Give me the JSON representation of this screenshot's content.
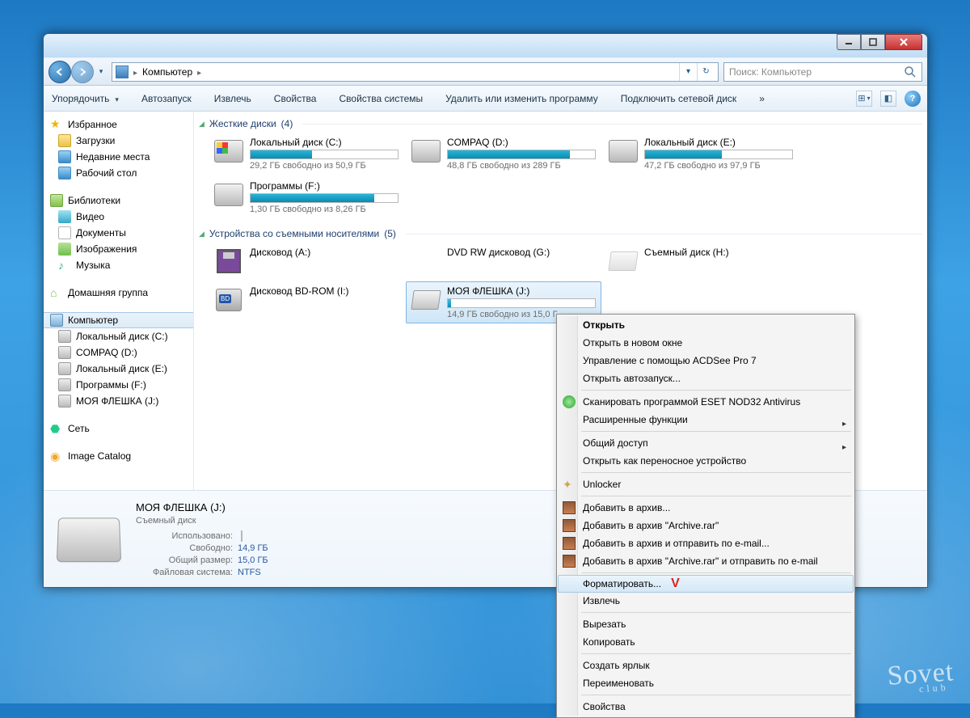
{
  "window": {
    "title": "Компьютер",
    "search_placeholder": "Поиск: Компьютер"
  },
  "toolbar": {
    "organize": "Упорядочить",
    "autoplay": "Автозапуск",
    "eject": "Извлечь",
    "properties": "Свойства",
    "sys_properties": "Свойства системы",
    "uninstall": "Удалить или изменить программу",
    "map_network": "Подключить сетевой диск",
    "more": "»"
  },
  "sidebar": {
    "favorites": {
      "label": "Избранное",
      "items": [
        "Загрузки",
        "Недавние места",
        "Рабочий стол"
      ]
    },
    "libraries": {
      "label": "Библиотеки",
      "items": [
        "Видео",
        "Документы",
        "Изображения",
        "Музыка"
      ]
    },
    "homegroup": "Домашняя группа",
    "computer": {
      "label": "Компьютер",
      "items": [
        "Локальный диск (C:)",
        "COMPAQ (D:)",
        "Локальный диск (E:)",
        "Программы  (F:)",
        "МОЯ ФЛЕШКА (J:)"
      ]
    },
    "network": "Сеть",
    "image_catalog": "Image Catalog"
  },
  "groups": {
    "hdd": {
      "label": "Жесткие диски",
      "count": "(4)"
    },
    "removable": {
      "label": "Устройства со съемными носителями",
      "count": "(5)"
    }
  },
  "drives": {
    "c": {
      "name": "Локальный диск (C:)",
      "sub": "29,2 ГБ свободно из 50,9 ГБ",
      "fill": 42,
      "color": "#25b6d8"
    },
    "d": {
      "name": "COMPAQ (D:)",
      "sub": "48,8 ГБ свободно из 289 ГБ",
      "fill": 83,
      "color": "#25b6d8"
    },
    "e": {
      "name": "Локальный диск (E:)",
      "sub": "47,2 ГБ свободно из 97,9 ГБ",
      "fill": 52,
      "color": "#25b6d8"
    },
    "f": {
      "name": "Программы  (F:)",
      "sub": "1,30 ГБ свободно из 8,26 ГБ",
      "fill": 84,
      "color": "#25b6d8"
    },
    "a": {
      "name": "Дисковод (A:)"
    },
    "g": {
      "name": "DVD RW дисковод (G:)"
    },
    "h": {
      "name": "Съемный диск (H:)"
    },
    "i": {
      "name": "Дисковод BD-ROM (I:)"
    },
    "j": {
      "name": "МОЯ ФЛЕШКА (J:)",
      "sub": "14,9 ГБ свободно из 15,0 Г",
      "fill": 2,
      "color": "#3fbfe5"
    }
  },
  "details": {
    "title": "МОЯ ФЛЕШКА (J:)",
    "type": "Съемный диск",
    "used_label": "Использовано:",
    "free_label": "Свободно:",
    "free_val": "14,9 ГБ",
    "size_label": "Общий размер:",
    "size_val": "15,0 ГБ",
    "fs_label": "Файловая система:",
    "fs_val": "NTFS",
    "used_fill": 2
  },
  "context_menu": {
    "open": "Открыть",
    "open_new": "Открыть в новом окне",
    "acdsee": "Управление с помощью ACDSee Pro 7",
    "autoplay": "Открыть автозапуск...",
    "eset_scan": "Сканировать программой ESET NOD32 Antivirus",
    "advanced": "Расширенные функции",
    "share": "Общий доступ",
    "portable": "Открыть как переносное устройство",
    "unlocker": "Unlocker",
    "add_archive": "Добавить в архив...",
    "add_archive_rar": "Добавить в архив \"Archive.rar\"",
    "add_email": "Добавить в архив и отправить по e-mail...",
    "add_rar_email": "Добавить в архив \"Archive.rar\" и отправить по e-mail",
    "format": "Форматировать...",
    "eject": "Извлечь",
    "cut": "Вырезать",
    "copy": "Копировать",
    "shortcut": "Создать ярлык",
    "rename": "Переименовать",
    "props": "Свойства"
  },
  "watermark": {
    "brand": "Sovet",
    "sub": "club"
  }
}
